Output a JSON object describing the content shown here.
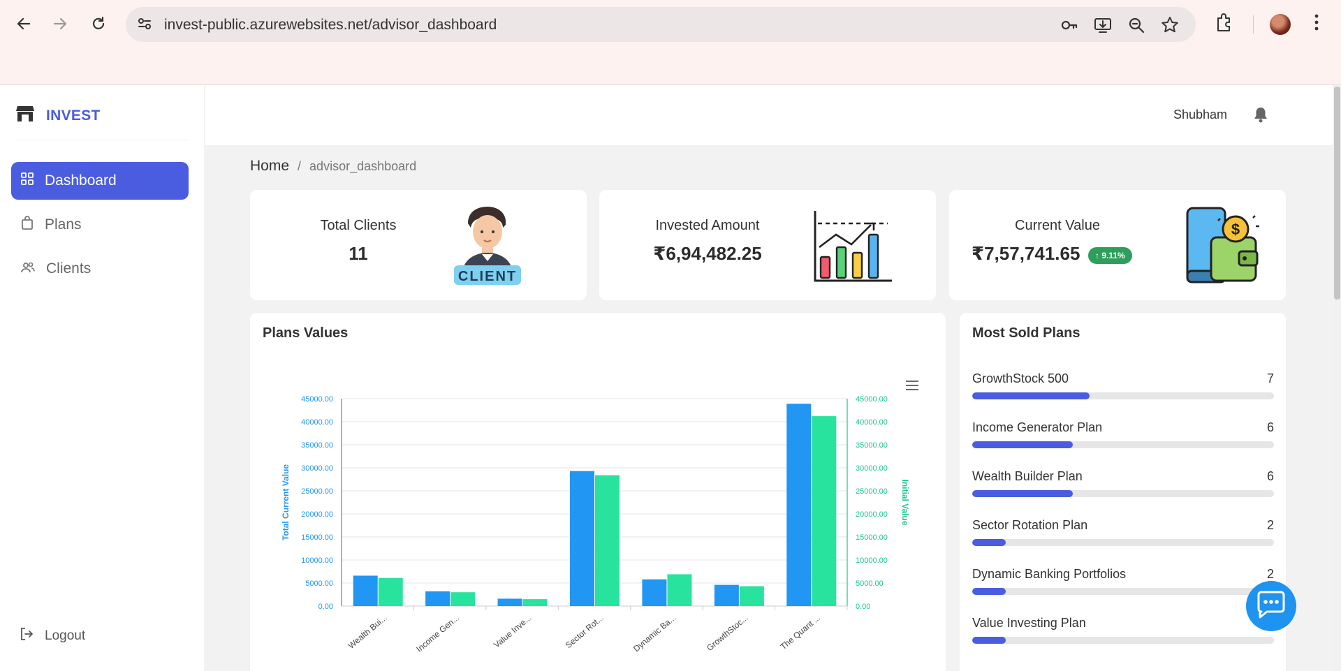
{
  "browser": {
    "url": "invest-public.azurewebsites.net/advisor_dashboard",
    "icons": [
      "back-icon",
      "forward-icon",
      "reload-icon",
      "site-settings-icon",
      "password-key-icon",
      "install-app-icon",
      "zoom-icon",
      "bookmark-star-icon",
      "extensions-icon",
      "profile-avatar",
      "menu-kebab-icon"
    ]
  },
  "sidebar": {
    "brand": "INVEST",
    "items": [
      {
        "label": "Dashboard",
        "icon": "grid-icon",
        "active": true
      },
      {
        "label": "Plans",
        "icon": "bag-icon",
        "active": false
      },
      {
        "label": "Clients",
        "icon": "users-icon",
        "active": false
      }
    ],
    "logout": "Logout"
  },
  "header": {
    "user": "Shubham"
  },
  "breadcrumb": {
    "home": "Home",
    "separator": "/",
    "current": "advisor_dashboard"
  },
  "stats": {
    "total_clients": {
      "label": "Total Clients",
      "value": "11",
      "image_text": "CLIENT"
    },
    "invested_amount": {
      "label": "Invested Amount",
      "value": "₹6,94,482.25"
    },
    "current_value": {
      "label": "Current Value",
      "value": "₹7,57,741.65",
      "badge": "↑ 9.11%"
    }
  },
  "plans_values": {
    "title": "Plans Values"
  },
  "chart_data": {
    "type": "bar",
    "categories": [
      "Wealth Bui...",
      "Income Gen...",
      "Value Inve...",
      "Sector Rot...",
      "Dynamic Ba...",
      "GrowthStoc...",
      "The Quant ..."
    ],
    "series": [
      {
        "name": "Total Current Value",
        "values": [
          6600,
          3200,
          1600,
          29300,
          5800,
          4600,
          43900
        ],
        "color": "#2196f3"
      },
      {
        "name": "Initial Value",
        "values": [
          6100,
          3000,
          1500,
          28400,
          6900,
          4300,
          41200
        ],
        "color": "#28e39e"
      }
    ],
    "ylabel_left": "Total Current Value",
    "ylabel_right": "Initial Value",
    "ylim": [
      0,
      45000
    ],
    "yticks": [
      "0.00",
      "5000.00",
      "10000.00",
      "15000.00",
      "20000.00",
      "25000.00",
      "30000.00",
      "35000.00",
      "40000.00",
      "45000.00"
    ],
    "grid": true
  },
  "most_sold": {
    "title": "Most Sold Plans",
    "max": 18,
    "plans": [
      {
        "name": "GrowthStock 500",
        "count": "7",
        "value": 7
      },
      {
        "name": "Income Generator Plan",
        "count": "6",
        "value": 6
      },
      {
        "name": "Wealth Builder Plan",
        "count": "6",
        "value": 6
      },
      {
        "name": "Sector Rotation Plan",
        "count": "2",
        "value": 2
      },
      {
        "name": "Dynamic Banking Portfolios",
        "count": "2",
        "value": 2
      },
      {
        "name": "Value Investing Plan",
        "count": "",
        "value": 2
      }
    ]
  },
  "colors": {
    "accent": "#4a5de0",
    "bar_blue": "#2196f3",
    "bar_green": "#28e39e",
    "badge_green": "#2e9e5b",
    "chat_blue": "#1e93f0"
  }
}
